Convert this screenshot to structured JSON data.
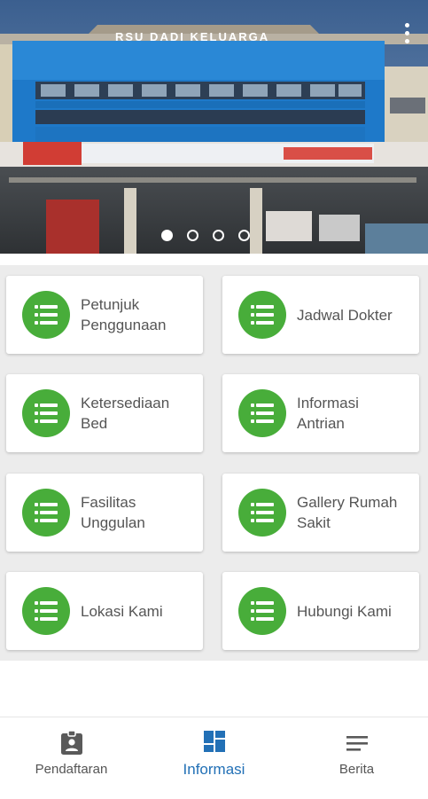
{
  "banner": {
    "image_icon": "hospital-building-photo",
    "building_sign": "RSU DADI KELUARGA",
    "slides": 4,
    "active_slide": 1
  },
  "menu": [
    {
      "label": "Petunjuk\nPenggunaan",
      "icon": "list-icon"
    },
    {
      "label": "Jadwal Dokter",
      "icon": "list-icon"
    },
    {
      "label": "Ketersediaan\nBed",
      "icon": "list-icon"
    },
    {
      "label": "Informasi\nAntrian",
      "icon": "list-icon"
    },
    {
      "label": "Fasilitas\nUnggulan",
      "icon": "list-icon"
    },
    {
      "label": "Gallery Rumah\nSakit",
      "icon": "list-icon"
    },
    {
      "label": "Lokasi Kami",
      "icon": "list-icon"
    },
    {
      "label": "Hubungi Kami",
      "icon": "list-icon"
    }
  ],
  "nav": {
    "items": [
      {
        "label": "Pendaftaran",
        "icon": "id-badge-icon"
      },
      {
        "label": "Informasi",
        "icon": "dashboard-icon"
      },
      {
        "label": "Berita",
        "icon": "menu-lines-icon"
      }
    ],
    "active": "Informasi"
  },
  "colors": {
    "accent_green": "#48ad3a",
    "active_nav_blue": "#2270b6",
    "text_gray": "#555555"
  }
}
